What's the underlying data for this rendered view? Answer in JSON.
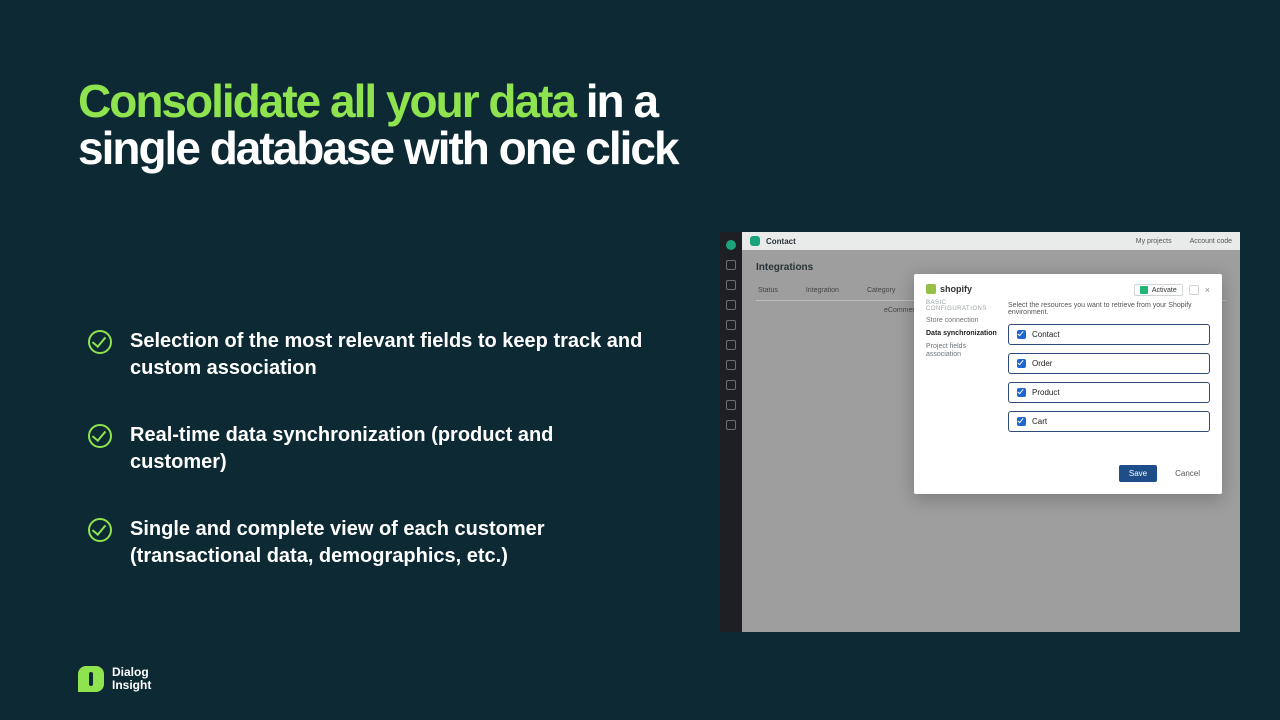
{
  "hero": {
    "accent": "Consolidate all your data",
    "rest": "in a single database with one click"
  },
  "bullets": [
    "Selection of the most relevant fields to keep track and custom association",
    " Real-time data synchronization (product and customer)",
    "Single and complete view of each customer (transactional data, demographics, etc.)"
  ],
  "brand": {
    "name": "Dialog\nInsight"
  },
  "app": {
    "titlebar": {
      "title": "Contact",
      "link_projects": "My projects",
      "link_account": "Account code"
    },
    "heading": "Integrations",
    "columns": {
      "status": "Status",
      "integration": "Integration",
      "category": "Category"
    },
    "row": {
      "status": "",
      "integration": "",
      "category": "eCommerce"
    },
    "modal": {
      "brand": "shopify",
      "section_label": "BASIC CONFIGURATIONS",
      "nav": {
        "store": "Store connection",
        "data": "Data synchronization",
        "fields": "Project fields association"
      },
      "activate": "Activate",
      "description": "Select the resources you want to retrieve from your Shopify environment.",
      "resources": [
        "Contact",
        "Order",
        "Product",
        "Cart"
      ],
      "save": "Save",
      "cancel": "Cancel"
    }
  }
}
